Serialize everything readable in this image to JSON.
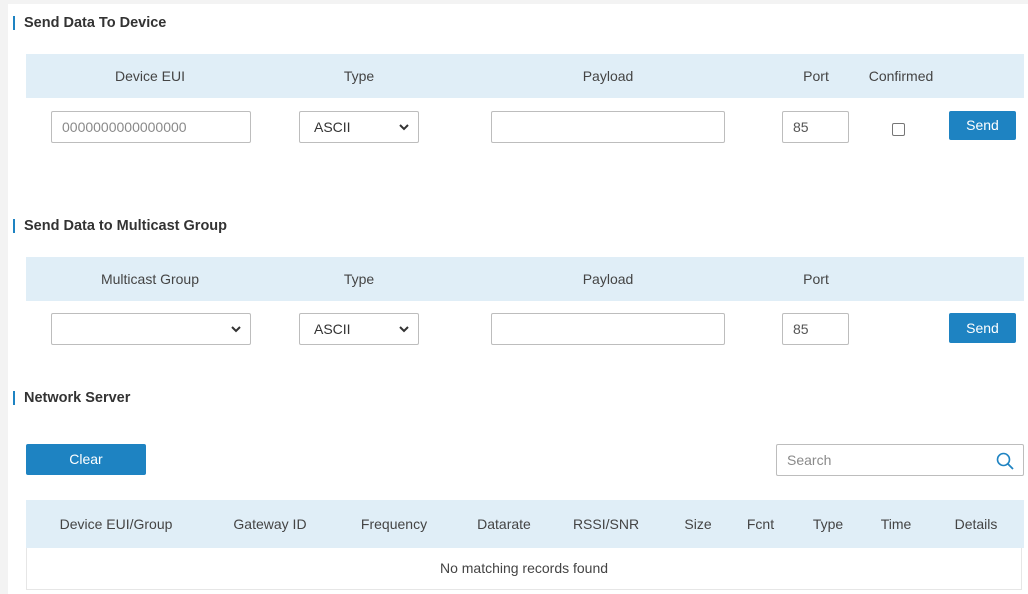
{
  "send_device": {
    "title": "Send Data To Device",
    "headers": {
      "device_eui": "Device EUI",
      "type": "Type",
      "payload": "Payload",
      "port": "Port",
      "confirmed": "Confirmed"
    },
    "device_eui_placeholder": "0000000000000000",
    "type_value": "ASCII",
    "payload_value": "",
    "port_value": "85",
    "confirmed_checked": false,
    "send_label": "Send"
  },
  "send_multicast": {
    "title": "Send Data to Multicast Group",
    "headers": {
      "group": "Multicast Group",
      "type": "Type",
      "payload": "Payload",
      "port": "Port"
    },
    "group_value": "",
    "type_value": "ASCII",
    "payload_value": "",
    "port_value": "85",
    "send_label": "Send"
  },
  "network_server": {
    "title": "Network Server",
    "clear_label": "Clear",
    "search_placeholder": "Search",
    "columns": [
      "Device EUI/Group",
      "Gateway ID",
      "Frequency",
      "Datarate",
      "RSSI/SNR",
      "Size",
      "Fcnt",
      "Type",
      "Time",
      "Details"
    ],
    "empty_message": "No matching records found"
  },
  "colors": {
    "accent": "#1e83c2",
    "header_bg": "#e0eef7",
    "page_bg": "#f3f3f3"
  },
  "icons": {
    "select_arrow": "chevron-down-icon",
    "search": "search-icon"
  }
}
